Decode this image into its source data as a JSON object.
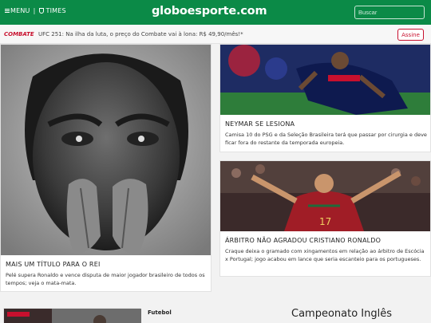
{
  "header": {
    "menu_label": "MENU",
    "times_label": "TIMES",
    "logo": "globoesporte.com",
    "search_placeholder": "Buscar"
  },
  "promo": {
    "brand": "COMBATE",
    "text": "UFC 251: Na ilha da luta, o preço do Combate vai à lona: R$ 49,90/mês!*",
    "button": "Assine"
  },
  "cards": {
    "main": {
      "title": "MAIS UM TÍTULO PARA O REI",
      "desc": "Pelé supera Ronaldo e vence disputa de maior jogador brasileiro de todos os tempos; veja o mata-mata."
    },
    "neymar": {
      "title": "NEYMAR SE LESIONA",
      "desc": "Camisa 10 do PSG e da Seleção Brasileira terá que passar por cirurgia e deve ficar fora do restante da temporada europeia."
    },
    "ronaldo": {
      "title": "ÁRBITRO NÃO AGRADOU CRISTIANO RONALDO",
      "desc": "Craque deixa o gramado com xingamentos em relação ao árbitro de Escócia x Portugal; jogo acabou em lance que seria escanteio para os portugueses."
    }
  },
  "bottom": {
    "section_label": "Futebol",
    "league_title": "Campeonato Inglês"
  },
  "colors": {
    "brand_green": "#0b8a47",
    "promo_red": "#c8102e"
  }
}
